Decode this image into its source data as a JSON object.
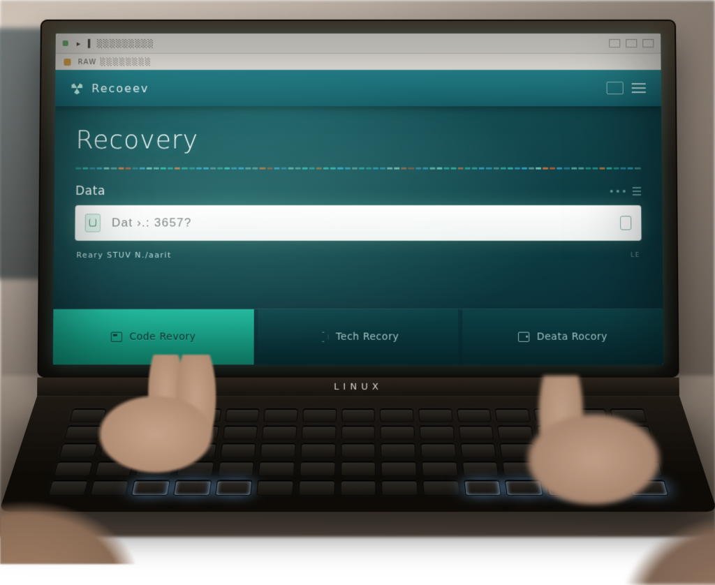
{
  "os_chrome": {
    "menu_hint": "▸",
    "address_hint": "▍ ░░░░░░░░░"
  },
  "tabstrip": {
    "label": "RAW  ░░░░░░░░"
  },
  "titlebar": {
    "brand": "Recoeev"
  },
  "main": {
    "heading": "Recovery",
    "section_label": "Data",
    "status_line": "Reary STUV N./aarit"
  },
  "field": {
    "value": "",
    "placeholder": "Dat ›.: 3657?"
  },
  "tiles": [
    {
      "icon": "card",
      "label": "Code Revory"
    },
    {
      "icon": "hexsm",
      "label": "Tech Recory"
    },
    {
      "icon": "drive",
      "label": "Deata Rocory"
    }
  ],
  "device": {
    "brand": "LINUX"
  },
  "titlebar_labels": {
    "le_tag": "LE",
    "lt_tag": "▫"
  },
  "scan_colors": [
    "#2fc3b0",
    "#2fc3b0",
    "#34b7d8",
    "#34b7d8",
    "#7fd0c2",
    "#7fd0c2",
    "#e07a3a",
    "#cf5f2e",
    "#3aa0c2",
    "#3aa0c2",
    "#6fd3c0",
    "#6fd3c0",
    "#2fc3b0",
    "#2fc3b0",
    "#e0893a",
    "#2fc3b0",
    "#2fc3b0",
    "#34b7d8",
    "#34b7d8",
    "#7fd0c2"
  ]
}
